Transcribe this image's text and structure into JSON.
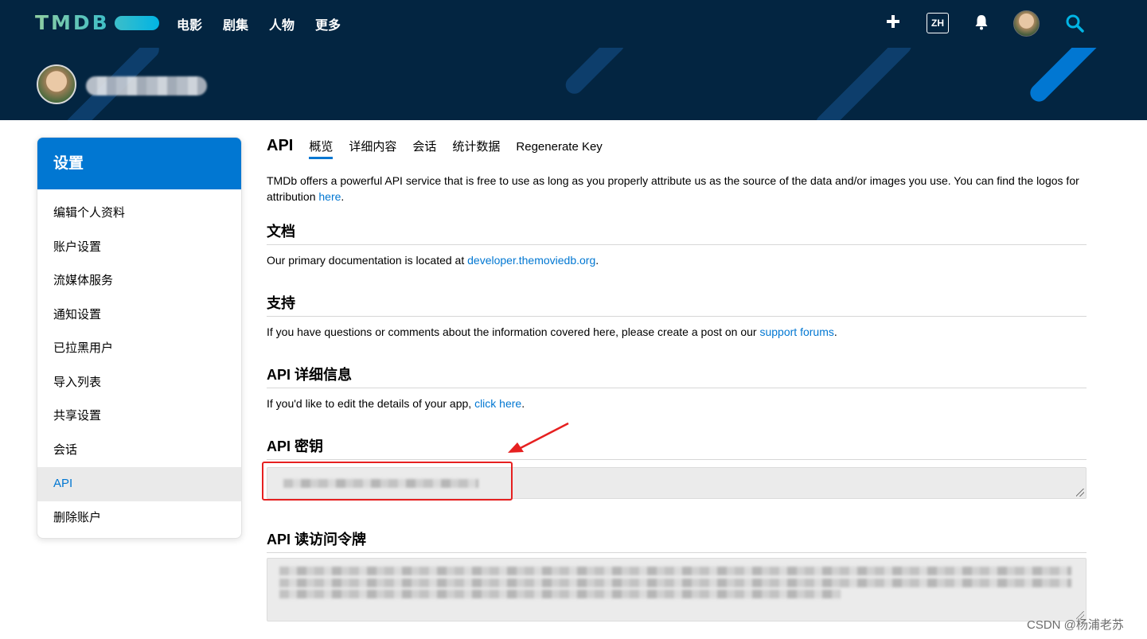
{
  "nav": {
    "logo": "TMDB",
    "menu": [
      "电影",
      "剧集",
      "人物",
      "更多"
    ],
    "lang": "ZH",
    "icons": {
      "add": "plus-icon",
      "notifications": "bell-icon",
      "search": "search-icon"
    },
    "colors": {
      "bg": "#032541",
      "accent": "#01b4e4",
      "primary": "#0177d2"
    }
  },
  "sidebar": {
    "title": "设置",
    "items": [
      "编辑个人资料",
      "账户设置",
      "流媒体服务",
      "通知设置",
      "已拉黑用户",
      "导入列表",
      "共享设置",
      "会话",
      "API",
      "删除账户"
    ],
    "active": "API"
  },
  "main": {
    "title": "API",
    "tabs": [
      "概览",
      "详细内容",
      "会话",
      "统计数据",
      "Regenerate Key"
    ],
    "active_tab": "概览",
    "intro": {
      "text": "TMDb offers a powerful API service that is free to use as long as you properly attribute us as the source of the data and/or images you use. You can find the logos for attribution ",
      "link": "here",
      "end": "."
    },
    "docs": {
      "heading": "文档",
      "text": "Our primary documentation is located at ",
      "link": "developer.themoviedb.org",
      "end": "."
    },
    "support": {
      "heading": "支持",
      "text": "If you have questions or comments about the information covered here, please create a post on our ",
      "link": "support forums",
      "end": "."
    },
    "details": {
      "heading": "API 详细信息",
      "text": "If you'd like to edit the details of your app, ",
      "link": "click here",
      "end": "."
    },
    "key": {
      "heading": "API 密钥"
    },
    "token": {
      "heading": "API 读访问令牌"
    }
  },
  "watermark": "CSDN @杨浦老苏"
}
